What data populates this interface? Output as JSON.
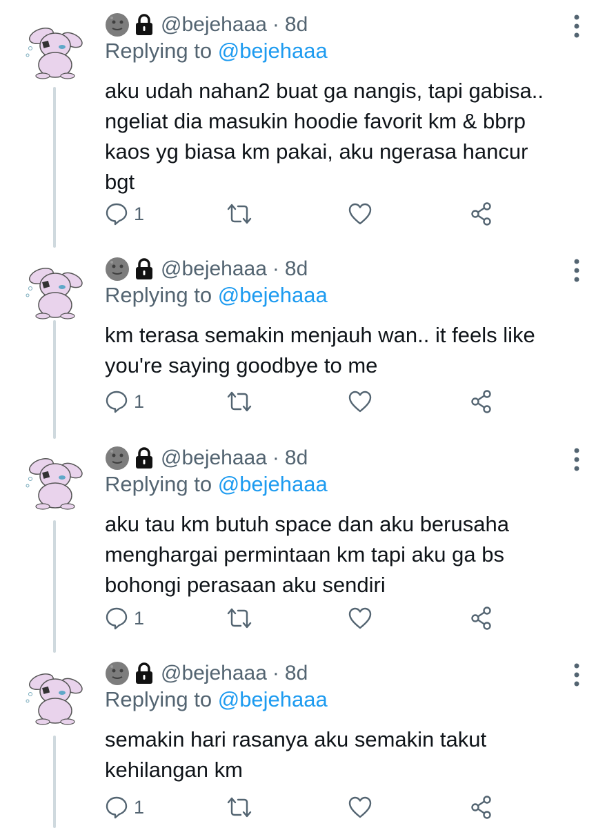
{
  "tweets": [
    {
      "handle": "@bejehaaa",
      "separator": "·",
      "time": "8d",
      "replying_prefix": "Replying to ",
      "replying_to": "@bejehaaa",
      "lines": [
        "aku udah nahan2 buat ga nangis, tapi gabisa..",
        "ngeliat dia masukin hoodie favorit km & bbrp",
        "kaos yg biasa km pakai, aku ngerasa hancur",
        "bgt"
      ],
      "reply_count": "1"
    },
    {
      "handle": "@bejehaaa",
      "separator": "·",
      "time": "8d",
      "replying_prefix": "Replying to ",
      "replying_to": "@bejehaaa",
      "lines": [
        "km terasa semakin menjauh wan.. it feels like",
        "you're saying goodbye to me"
      ],
      "reply_count": "1"
    },
    {
      "handle": "@bejehaaa",
      "separator": "·",
      "time": "8d",
      "replying_prefix": "Replying to ",
      "replying_to": "@bejehaaa",
      "lines": [
        "aku tau km butuh space dan aku berusaha",
        "menghargai permintaan km tapi aku ga bs",
        "bohongi perasaan aku sendiri"
      ],
      "reply_count": "1"
    },
    {
      "handle": "@bejehaaa",
      "separator": "·",
      "time": "8d",
      "replying_prefix": "Replying to ",
      "replying_to": "@bejehaaa",
      "lines": [
        "semakin hari rasanya aku semakin takut",
        "kehilangan km"
      ],
      "reply_count": "1"
    }
  ],
  "colors": {
    "text": "#0f1419",
    "secondary": "#536471",
    "link": "#1d9bf0",
    "thread_line": "#cfd9de",
    "avatar_bunny": "#e9d3ec"
  },
  "icons": {
    "avatar": "bunny-avatar",
    "name_emoji_1": "moon-face-emoji",
    "name_emoji_2": "lock-emoji",
    "more": "more-vertical-icon",
    "reply": "reply-icon",
    "retweet": "retweet-icon",
    "like": "heart-icon",
    "share": "share-icon"
  }
}
